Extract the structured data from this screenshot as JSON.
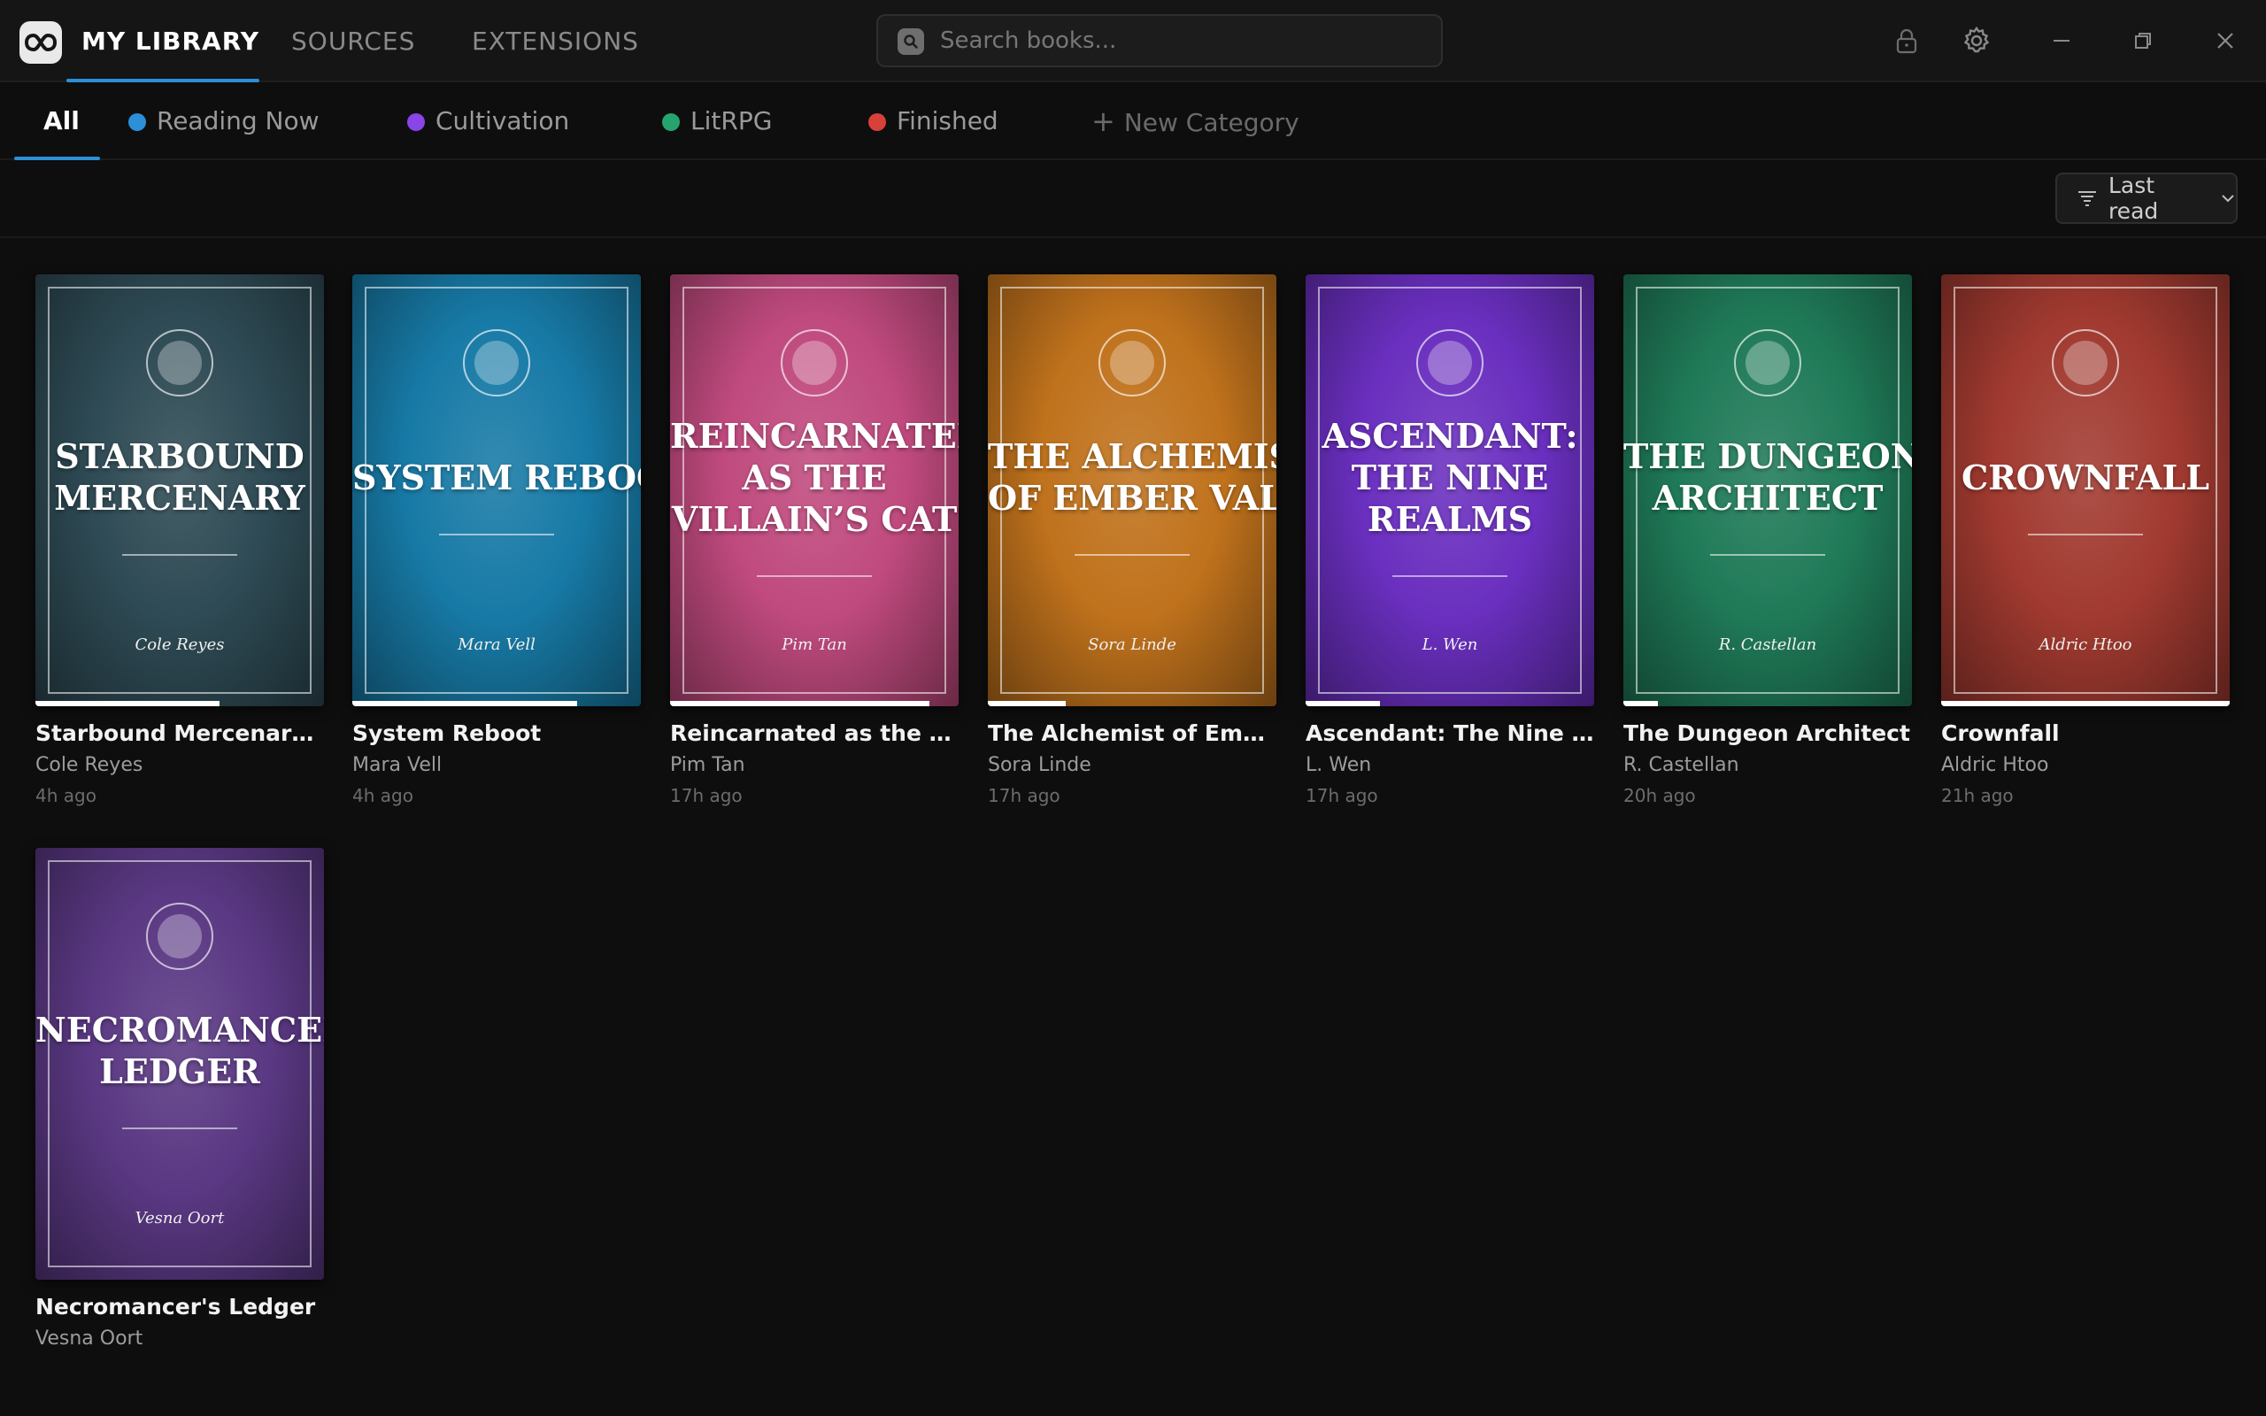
{
  "topbar": {
    "tabs": [
      "MY LIBRARY",
      "SOURCES",
      "EXTENSIONS"
    ],
    "active_tab": "MY LIBRARY",
    "search_placeholder": "Search books..."
  },
  "accent_color": "#2d8fd8",
  "categories": [
    {
      "label": "All",
      "color": ""
    },
    {
      "label": "Reading Now",
      "color": "#2d8fd8"
    },
    {
      "label": "Cultivation",
      "color": "#8a44e8"
    },
    {
      "label": "LitRPG",
      "color": "#25a56e"
    },
    {
      "label": "Finished",
      "color": "#d8403a"
    }
  ],
  "new_category_label": "New Category",
  "sort": {
    "label": "Last read"
  },
  "books": [
    {
      "title": "Starbound Mercenary",
      "display_title": "Starbound Mercenary...",
      "author": "Cole Reyes",
      "time": "4h ago",
      "cover_lines": [
        "STARBOUND",
        "MERCENARY"
      ],
      "color": "#2e4a54",
      "progress": 0.64
    },
    {
      "title": "System Reboot",
      "display_title": "System Reboot",
      "author": "Mara Vell",
      "time": "4h ago",
      "cover_lines": [
        "SYSTEM REBOOT"
      ],
      "color": "#177aa6",
      "progress": 0.78
    },
    {
      "title": "Reincarnated as the Villain's Cat",
      "display_title": "Reincarnated as the Villain...",
      "author": "Pim Tan",
      "time": "17h ago",
      "cover_lines": [
        "REINCARNATED",
        "AS THE",
        "VILLAIN’S CAT"
      ],
      "color": "#c04a7e",
      "progress": 0.9
    },
    {
      "title": "The Alchemist of Ember Vale",
      "display_title": "The Alchemist of Ember V...",
      "author": "Sora Linde",
      "time": "17h ago",
      "cover_lines": [
        "THE ALCHEMIST",
        "OF EMBER VALE"
      ],
      "color": "#c0721c",
      "progress": 0.27
    },
    {
      "title": "Ascendant: The Nine Realms",
      "display_title": "Ascendant: The Nine Real...",
      "author": "L. Wen",
      "time": "17h ago",
      "cover_lines": [
        "ASCENDANT:",
        "THE NINE",
        "REALMS"
      ],
      "color": "#6a2fbf",
      "progress": 0.26
    },
    {
      "title": "The Dungeon Architect",
      "display_title": "The Dungeon Architect",
      "author": "R. Castellan",
      "time": "20h ago",
      "cover_lines": [
        "THE DUNGEON",
        "ARCHITECT"
      ],
      "color": "#1f7a58",
      "progress": 0.12
    },
    {
      "title": "Crownfall",
      "display_title": "Crownfall",
      "author": "Aldric Htoo",
      "time": "21h ago",
      "cover_lines": [
        "CROWNFALL"
      ],
      "color": "#a13a30",
      "progress": 1.0
    },
    {
      "title": "Necromancer's Ledger",
      "display_title": "Necromancer's Ledger",
      "author": "Vesna Oort",
      "time": "",
      "cover_lines": [
        "NECROMANCER’S",
        "LEDGER"
      ],
      "color": "#5a3883",
      "progress": 0
    }
  ]
}
